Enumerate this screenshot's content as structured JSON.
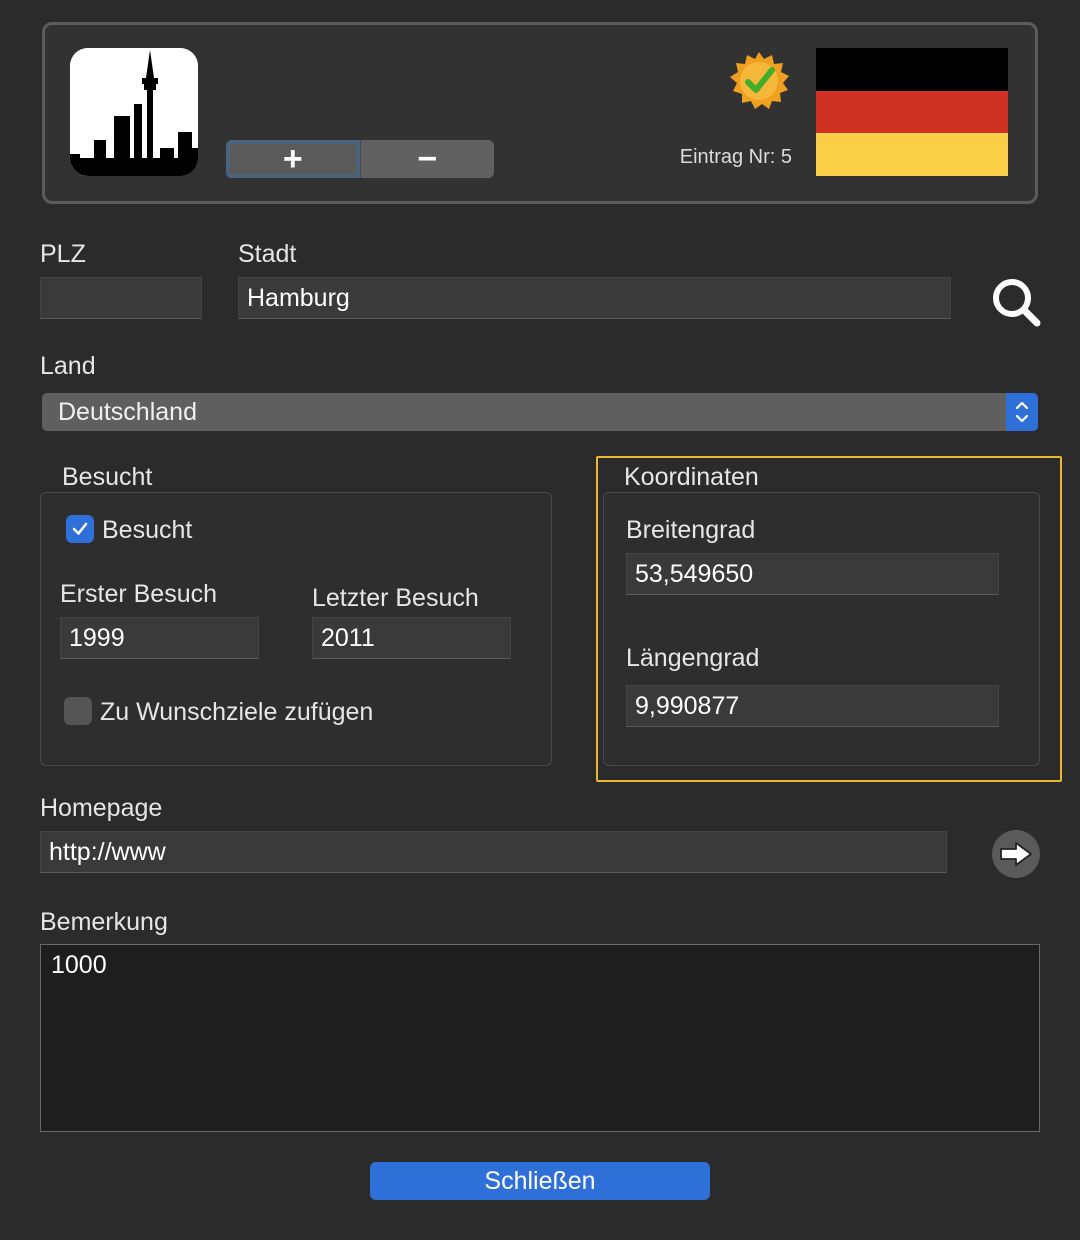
{
  "header": {
    "entry_label": "Eintrag Nr: 5",
    "add_label": "+",
    "remove_label": "−",
    "flag_colors": [
      "#000000",
      "#dd0000",
      "#ffce00"
    ]
  },
  "location": {
    "plz_label": "PLZ",
    "plz_value": "",
    "city_label": "Stadt",
    "city_value": "Hamburg",
    "country_label": "Land",
    "country_value": "Deutschland"
  },
  "visit": {
    "group_title": "Besucht",
    "visited_label": "Besucht",
    "visited_checked": true,
    "first_visit_label": "Erster Besuch",
    "first_visit_value": "1999",
    "last_visit_label": "Letzter Besuch",
    "last_visit_value": "2011",
    "wishlist_label": "Zu Wunschziele zufügen",
    "wishlist_checked": false
  },
  "coordinates": {
    "group_title": "Koordinaten",
    "lat_label": "Breitengrad",
    "lat_value": "53,549650",
    "lon_label": "Längengrad",
    "lon_value": "9,990877"
  },
  "homepage": {
    "label": "Homepage",
    "value": "http://www"
  },
  "remark": {
    "label": "Bemerkung",
    "value": "1000"
  },
  "footer": {
    "close_label": "Schließen"
  },
  "colors": {
    "accent": "#2f6fd8",
    "highlight": "#e8b830"
  }
}
